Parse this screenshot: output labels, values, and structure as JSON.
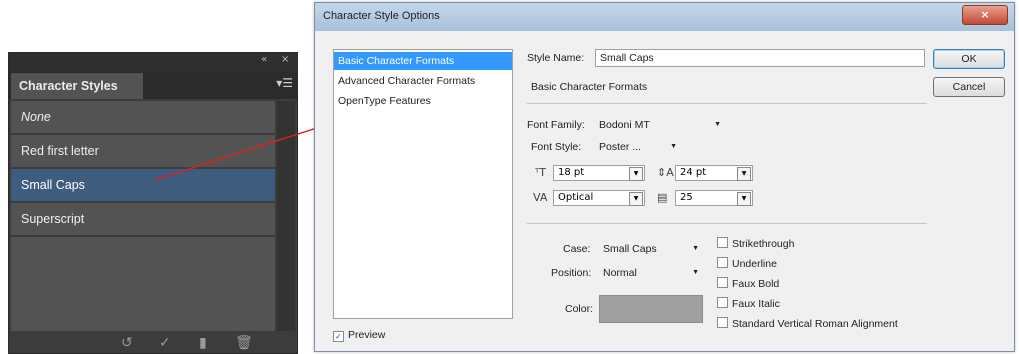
{
  "panel": {
    "collapse_glyph": "«",
    "close_glyph": "×",
    "tab_label": "Character Styles",
    "menu_glyph": "▾☰",
    "items": [
      {
        "label": "None"
      },
      {
        "label": "Red first letter"
      },
      {
        "label": "Small Caps"
      },
      {
        "label": "Superscript"
      }
    ],
    "selected_index": 2,
    "selected_color": "#3e5c7d",
    "bottom_icons": [
      "clear-overrides-icon",
      "redefine-style-icon",
      "new-style-icon",
      "delete-style-icon"
    ]
  },
  "annotation_color": "#e02020",
  "dialog": {
    "title": "Character Style Options",
    "close_glyph": "×",
    "categories": [
      "Basic Character Formats",
      "Advanced Character Formats",
      "OpenType Features"
    ],
    "selected_category": 0,
    "style_name_label": "Style Name:",
    "style_name_value": "Small Caps",
    "section_title": "Basic Character Formats",
    "font_family_label": "Font Family:",
    "font_family_value": "Bodoni MT",
    "font_style_label": "Font Style:",
    "font_style_value": "Poster ...",
    "font_size_value": "18 pt",
    "leading_value": "24 pt",
    "kerning_value": "Optical",
    "tracking_value": "25",
    "case_label": "Case:",
    "case_value": "Small Caps",
    "position_label": "Position:",
    "position_value": "Normal",
    "color_label": "Color:",
    "checkboxes": [
      "Strikethrough",
      "Underline",
      "Faux Bold",
      "Faux Italic",
      "Standard Vertical Roman Alignment"
    ],
    "preview_label": "Preview",
    "preview_checked": true,
    "ok_label": "OK",
    "cancel_label": "Cancel"
  }
}
